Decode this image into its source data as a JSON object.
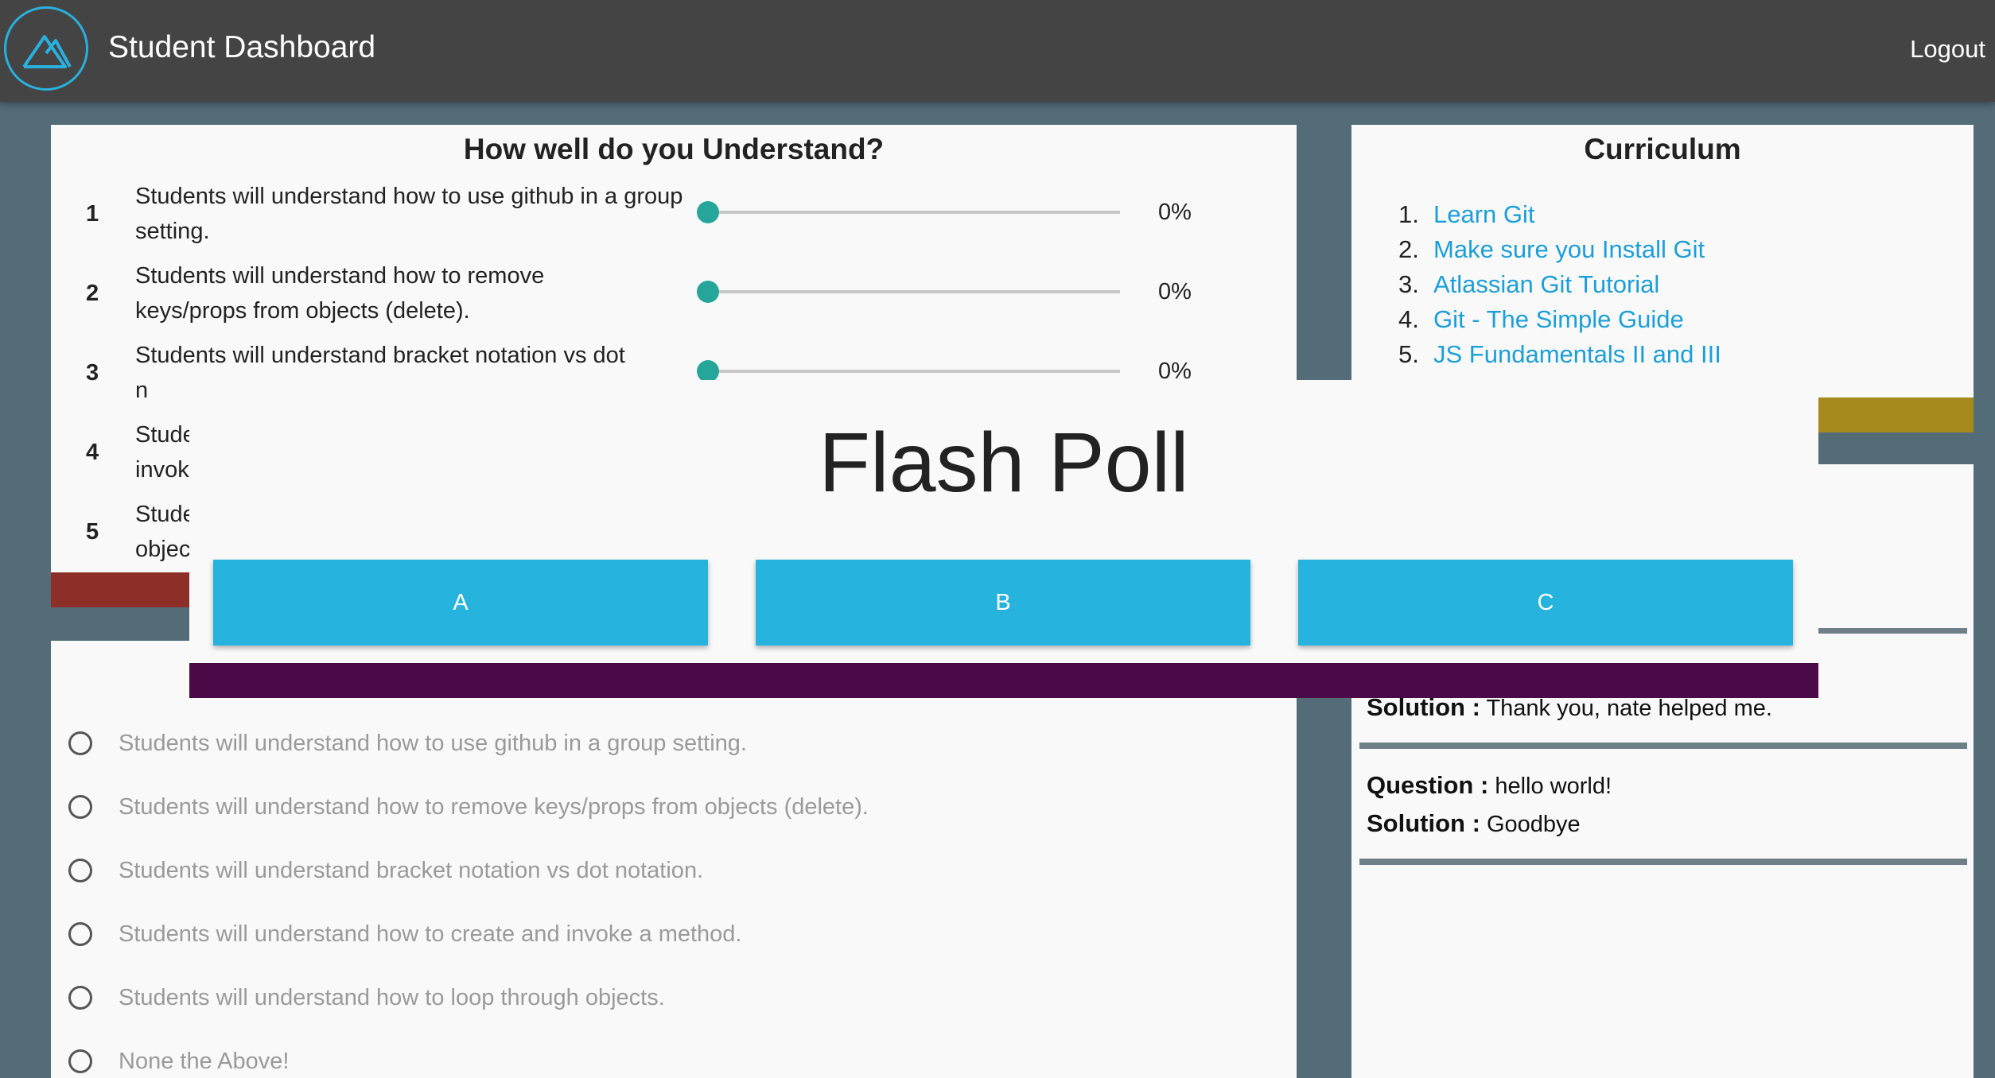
{
  "header": {
    "logo_icon": "mountain-logo-icon",
    "title": "Student Dashboard",
    "logout_label": "Logout"
  },
  "understanding": {
    "title": "How well do you Understand?",
    "objectives": [
      {
        "num": "1",
        "text": "Students will understand how to use github in a group setting.",
        "level": 0,
        "percent": "0%"
      },
      {
        "num": "2",
        "text": "Students will understand how to remove keys/props from objects (delete).",
        "level": 0,
        "percent": "0%"
      },
      {
        "num": "3",
        "text": "Students will understand bracket notation vs dot n",
        "level": 0,
        "percent": "0%"
      },
      {
        "num": "4",
        "text": "Stude invok"
      },
      {
        "num": "5",
        "text": "Stude objec"
      }
    ]
  },
  "curriculum": {
    "title": "Curriculum",
    "items": [
      {
        "num": "1.",
        "label": "Learn Git"
      },
      {
        "num": "2.",
        "label": "Make sure you Install Git"
      },
      {
        "num": "3.",
        "label": "Atlassian Git Tutorial"
      },
      {
        "num": "4.",
        "label": "Git - The Simple Guide"
      },
      {
        "num": "5.",
        "label": "JS Fundamentals II and III"
      }
    ]
  },
  "quiz": {
    "options": [
      "Students will understand how to use github in a group setting.",
      "Students will understand how to remove keys/props from objects (delete).",
      "Students will understand bracket notation vs dot notation.",
      "Students will understand how to create and invoke a method.",
      "Students will understand how to loop through objects.",
      "None the Above!"
    ]
  },
  "qa": {
    "question_key": "Question :",
    "solution_key": "Solution :",
    "entries": [
      {
        "solution": "Thank you, nate helped me."
      },
      {
        "question": "hello world!",
        "solution": "Goodbye"
      }
    ]
  },
  "flash_poll": {
    "title": "Flash Poll",
    "buttons": [
      "A",
      "B",
      "C"
    ]
  },
  "colors": {
    "header_bg": "#444444",
    "page_bg": "#536c78",
    "accent_teal": "#26a69a",
    "link_blue": "#1c9fd9",
    "poll_button": "#26b3dd",
    "modal_footer": "#4a0a47",
    "accent_red": "#8e2e29",
    "accent_gold": "#a78a1e"
  }
}
